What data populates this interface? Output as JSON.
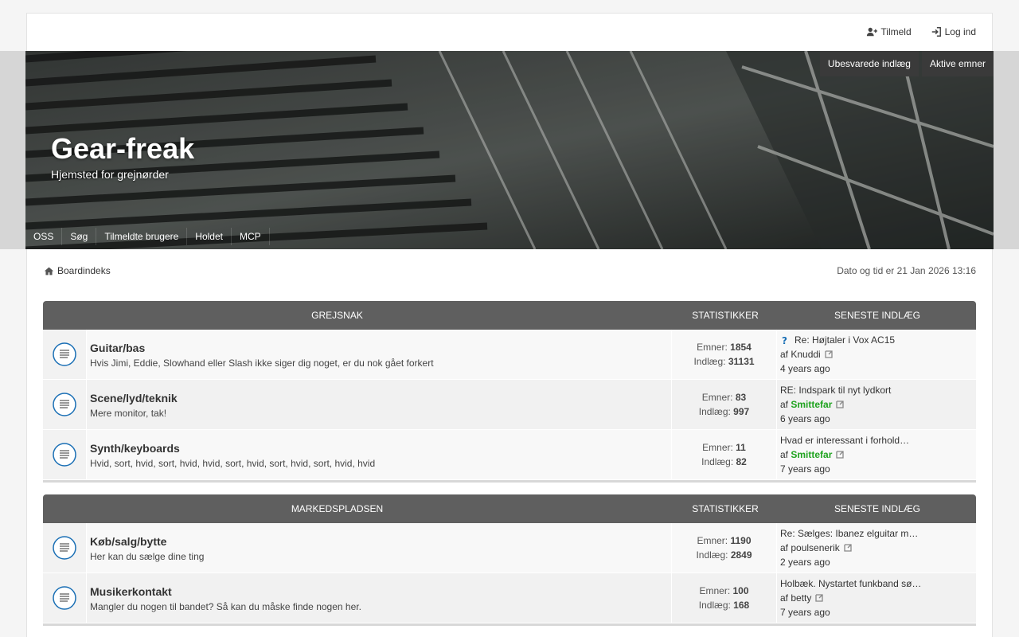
{
  "top": {
    "register": "Tilmeld",
    "login": "Log ind"
  },
  "hero": {
    "title": "Gear-freak",
    "subtitle": "Hjemsted for grejnørder",
    "buttons": [
      "Ubesvarede indlæg",
      "Aktive emner"
    ],
    "nav": [
      "OSS",
      "Søg",
      "Tilmeldte brugere",
      "Holdet",
      "MCP"
    ]
  },
  "crumb": {
    "index": "Boardindeks",
    "datetime": "Dato og tid er 21 Jan 2026 13:16"
  },
  "labels": {
    "stats": "STATISTIKKER",
    "last": "SENESTE INDLÆG",
    "topics": "Emner:",
    "posts": "Indlæg:",
    "by": "af"
  },
  "categories": [
    {
      "name": "GREJSNAK",
      "forums": [
        {
          "title": "Guitar/bas",
          "desc": "Hvis Jimi, Eddie, Slowhand eller Slash ikke siger dig noget, er du nok gået forkert",
          "topics": "1854",
          "posts": "31131",
          "last_title": "Re: Højtaler i Vox AC15",
          "last_author": "Knuddi",
          "last_time": "4 years ago"
        },
        {
          "title": "Scene/lyd/teknik",
          "desc": "Mere monitor, tak!",
          "topics": "83",
          "posts": "997",
          "last_title": "RE: Indspark til nyt lydkort",
          "last_author": "Smittefar",
          "last_time": "6 years ago"
        },
        {
          "title": "Synth/keyboards",
          "desc": "Hvid, sort, hvid, sort, hvid, hvid, sort, hvid, sort, hvid, sort, hvid, hvid",
          "topics": "11",
          "posts": "82",
          "last_title": "Hvad er interessant i forhold…",
          "last_author": "Smittefar",
          "last_time": "7 years ago"
        }
      ]
    },
    {
      "name": "MARKEDSPLADSEN",
      "forums": [
        {
          "title": "Køb/salg/bytte",
          "desc": "Her kan du sælge dine ting",
          "topics": "1190",
          "posts": "2849",
          "last_title": "Re: Sælges: Ibanez elguitar m…",
          "last_author": "poulsenerik",
          "last_time": "2 years ago"
        },
        {
          "title": "Musikerkontakt",
          "desc": "Mangler du nogen til bandet? Så kan du måske finde nogen her.",
          "topics": "100",
          "posts": "168",
          "last_title": "Holbæk. Nystartet funkband sø…",
          "last_author": "betty",
          "last_time": "7 years ago"
        }
      ]
    }
  ],
  "colors": {
    "header_bar": "#5f5f5f",
    "moderator_name": "#1fa31f",
    "forum_icon": "#1a6fb5"
  }
}
